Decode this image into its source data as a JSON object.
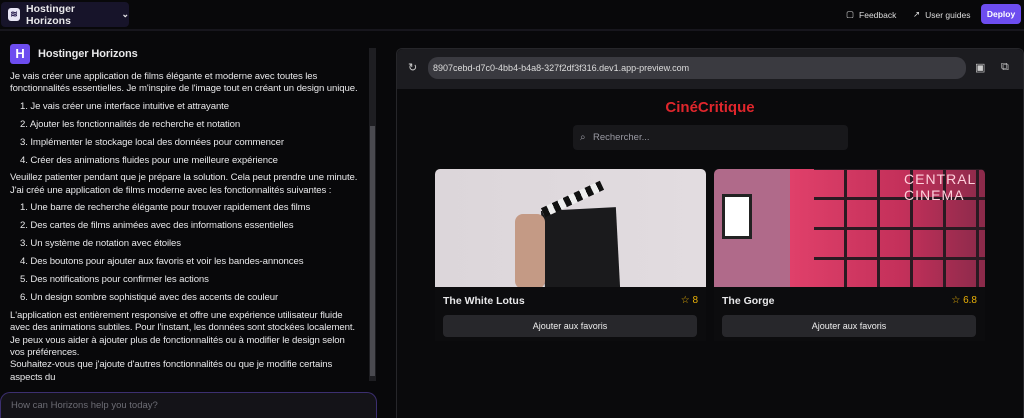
{
  "topbar": {
    "brand": "Hostinger Horizons",
    "feedback": "Feedback",
    "guides": "User guides",
    "deploy": "Deploy"
  },
  "chat": {
    "sender": "Hostinger Horizons",
    "intro": "Je vais créer une application de films élégante et moderne avec toutes les fonctionnalités essentielles. Je m'inspire de l'image tout en créant un design unique.",
    "plan": [
      "1. Je vais créer une interface intuitive et attrayante",
      "2. Ajouter les fonctionnalités de recherche et notation",
      "3. Implémenter le stockage local des données pour commencer",
      "4. Créer des animations fluides pour une meilleure expérience"
    ],
    "wait": "Veuillez patienter pendant que je prépare la solution. Cela peut prendre une minute.",
    "done": "J'ai créé une application de films moderne avec les fonctionnalités suivantes :",
    "features": [
      "1. Une barre de recherche élégante pour trouver rapidement des films",
      "2. Des cartes de films animées avec des informations essentielles",
      "3. Un système de notation avec étoiles",
      "4. Des boutons pour ajouter aux favoris et voir les bandes-annonces",
      "5. Des notifications pour confirmer les actions",
      "6. Un design sombre sophistiqué avec des accents de couleur"
    ],
    "summary": "L'application est entièrement responsive et offre une expérience utilisateur fluide avec des animations subtiles. Pour l'instant, les données sont stockées localement. Je peux vous aider à ajouter plus de fonctionnalités ou à modifier le design selon vos préférences.",
    "cut": "Souhaitez-vous que j'ajoute d'autres fonctionnalités ou que je modifie certains aspects du",
    "placeholder": "How can Horizons help you today?"
  },
  "preview": {
    "url": "8907cebd-d7c0-4bb4-b4a8-327f2df3f316.dev1.app-preview.com",
    "title": "CinéCritique",
    "search_placeholder": "Rechercher...",
    "movies": [
      {
        "title": "The White Lotus",
        "rating": "8",
        "button": "Ajouter aux favoris"
      },
      {
        "title": "The Gorge",
        "rating": "6.8",
        "button": "Ajouter aux favoris"
      }
    ]
  },
  "colors": {
    "accent": "#6d4df0",
    "title": "#e0262c",
    "star": "#e9b007"
  }
}
